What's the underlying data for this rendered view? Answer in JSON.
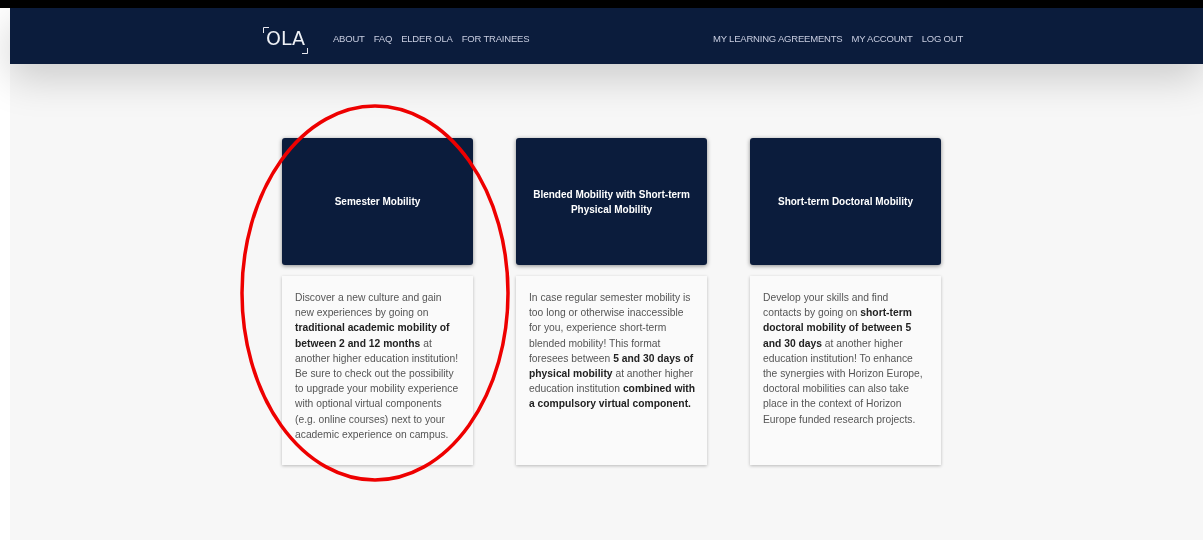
{
  "nav": {
    "logo": "OLA",
    "left_links": [
      "ABOUT",
      "FAQ",
      "ELDER OLA",
      "FOR TRAINEES"
    ],
    "right_links": [
      "MY LEARNING AGREEMENTS",
      "MY ACCOUNT",
      "LOG OUT"
    ]
  },
  "cards": [
    {
      "title": "Semester Mobility",
      "description": "Discover a new culture and gain new experiences by going on **traditional academic mobility of between 2 and 12 months** at another higher education institution! Be sure to check out the possibility to upgrade your mobility experience with optional virtual components (e.g. online courses) next to your academic experience on campus.",
      "circled": true
    },
    {
      "title": "Blended Mobility with Short-term Physical Mobility",
      "description": "In case regular semester mobility is too long or otherwise inaccessible for you, experience short-term blended mobility! This format foresees between **5 and 30 days of physical mobility** at another higher education institution **combined with a compulsory virtual component.**",
      "circled": false
    },
    {
      "title": "Short-term Doctoral Mobility",
      "description": "Develop your skills and find contacts by going on **short-term doctoral mobility of between 5 and 30 days** at another higher education institution! To enhance the synergies with Horizon Europe, doctoral mobilities can also take place in the context of Horizon Europe funded research projects.",
      "circled": false
    }
  ]
}
